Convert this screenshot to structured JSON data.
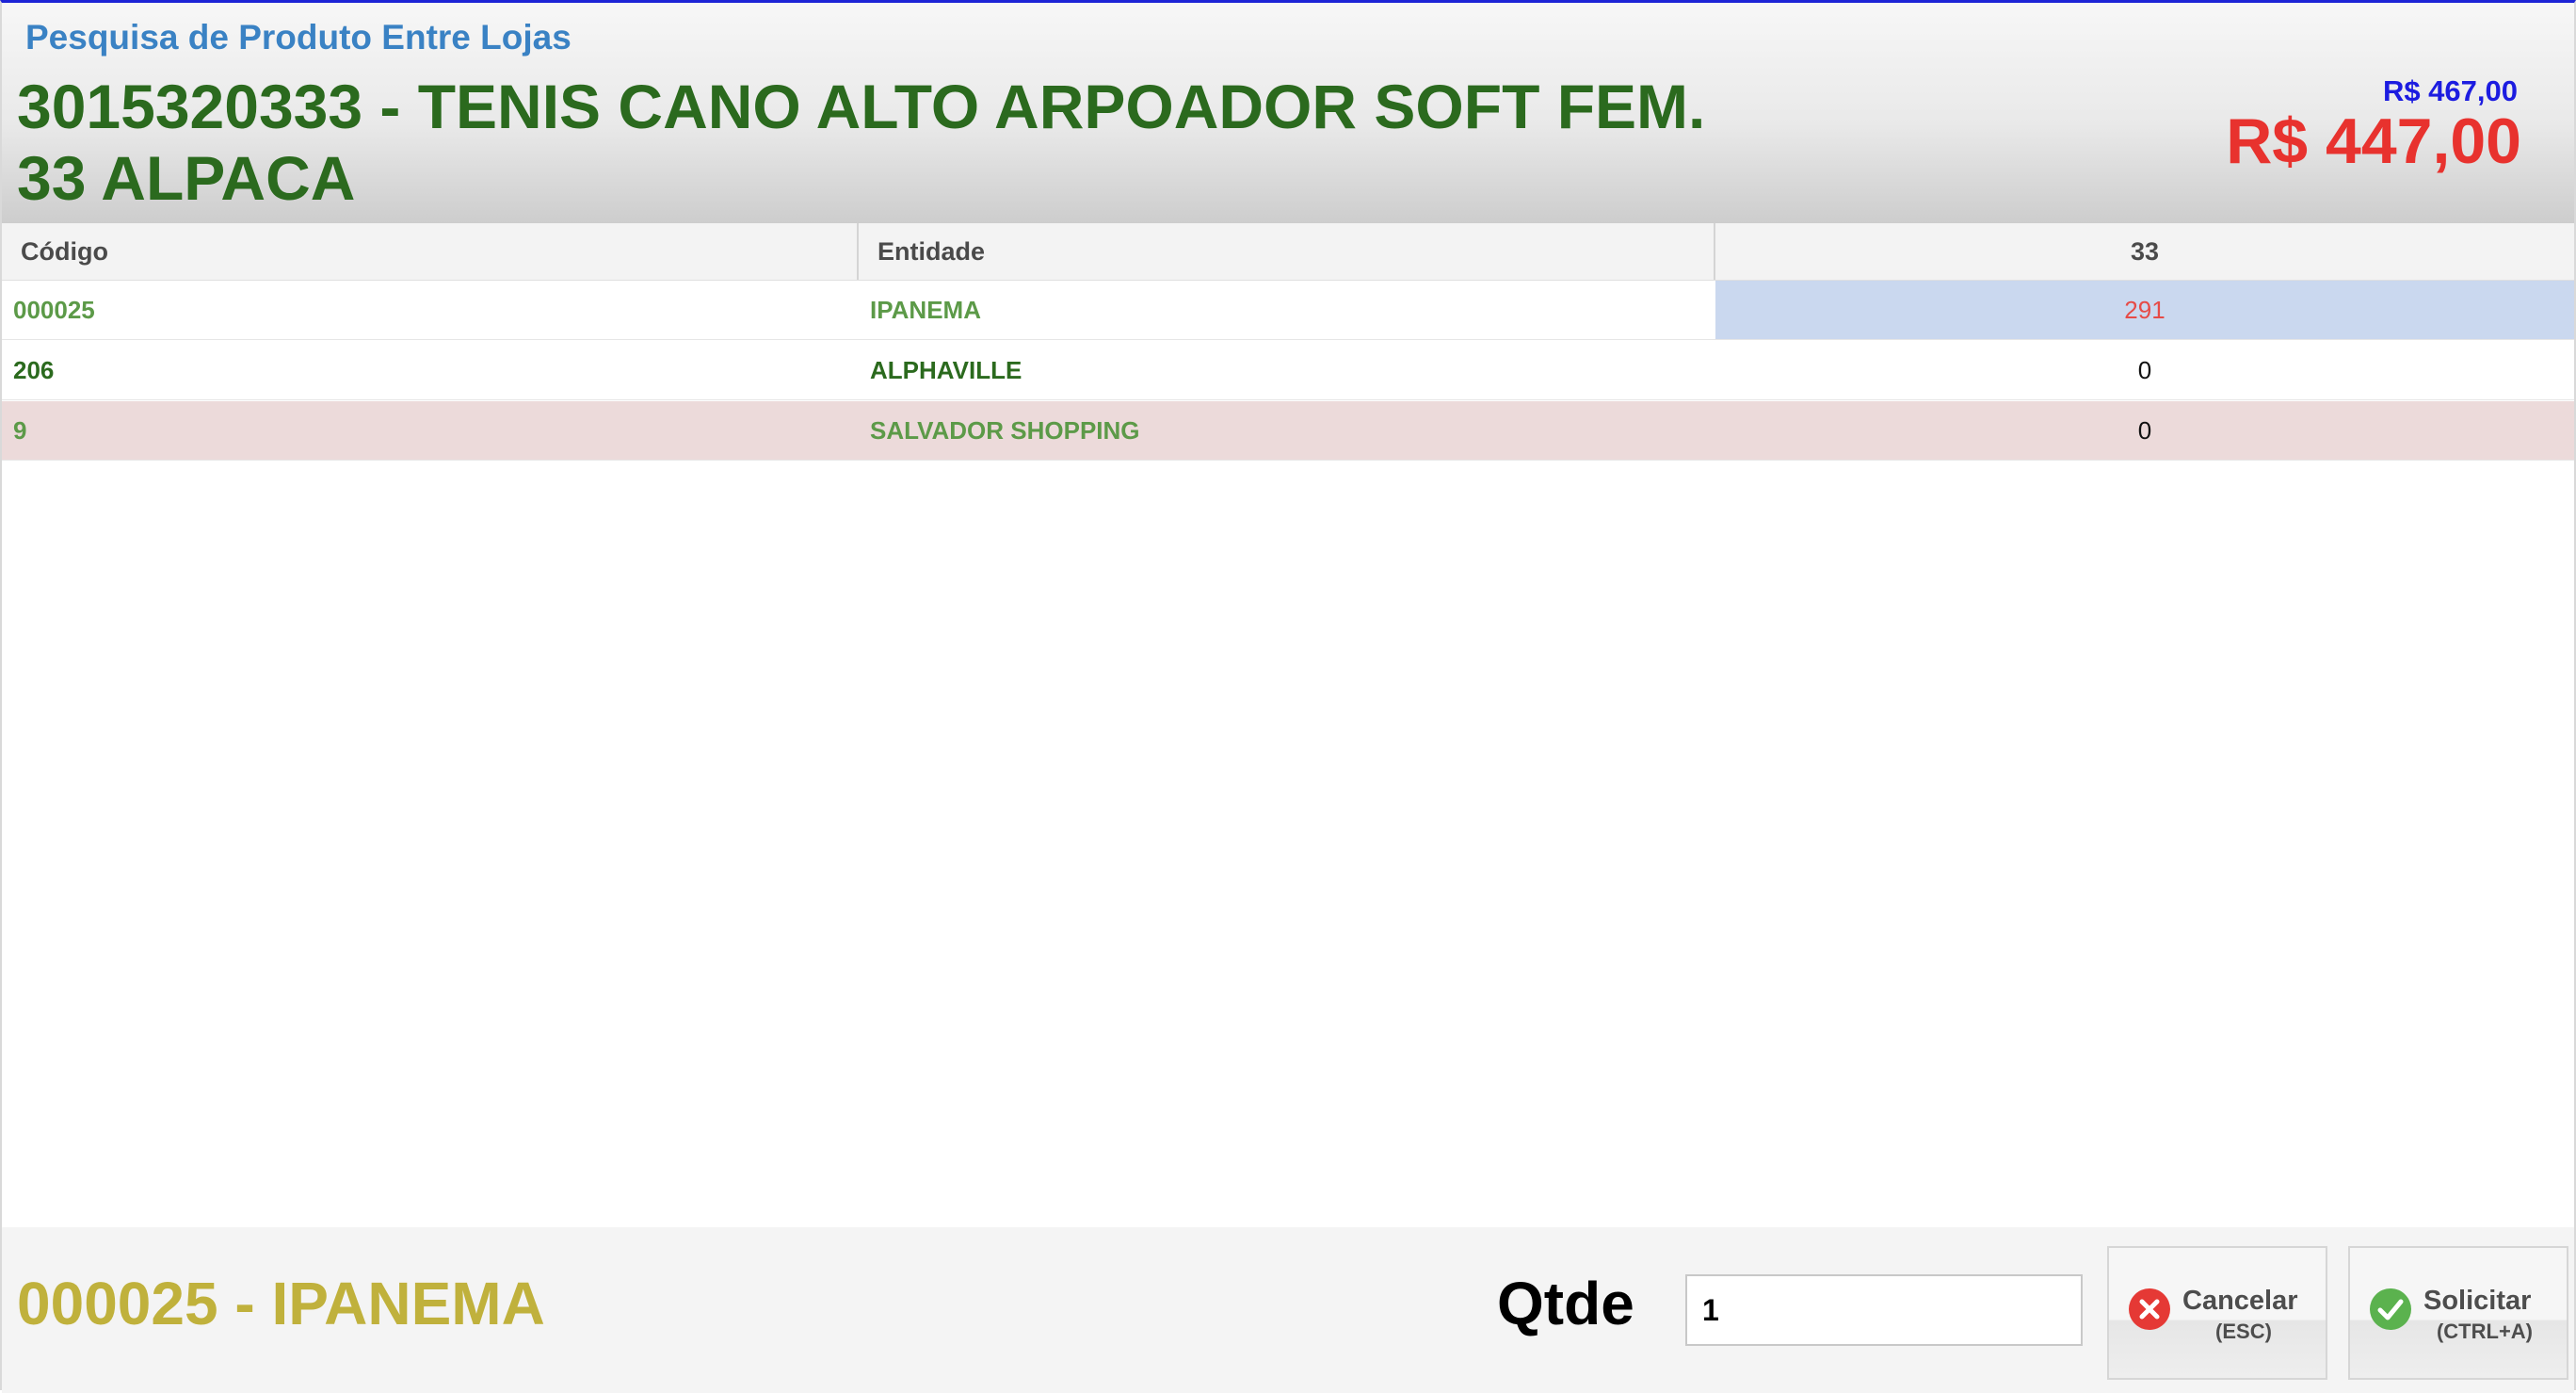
{
  "dialog": {
    "title": "Pesquisa de Produto Entre Lojas"
  },
  "product": {
    "name": "3015320333 - TENIS CANO ALTO ARPOADOR SOFT FEM. 33 ALPACA",
    "price_original": "R$ 467,00",
    "price_current": "R$ 447,00"
  },
  "grid": {
    "columns": {
      "code": "Código",
      "entity": "Entidade",
      "qty": "33"
    },
    "rows": [
      {
        "code": "000025",
        "entity": "IPANEMA",
        "qty": "291"
      },
      {
        "code": "206",
        "entity": "ALPHAVILLE",
        "qty": "0"
      },
      {
        "code": "9",
        "entity": "SALVADOR SHOPPING",
        "qty": "0"
      }
    ]
  },
  "footer": {
    "selected": "000025 - IPANEMA",
    "qty_label": "Qtde",
    "qty_value": "1",
    "cancel_label": "Cancelar",
    "cancel_shortcut": "(ESC)",
    "request_label": "Solicitar",
    "request_shortcut": "(CTRL+A)"
  },
  "colors": {
    "title_blue": "#3a82c4",
    "product_green": "#2b6a1e",
    "price_old_blue": "#1c1ce0",
    "price_new_red": "#e8322e",
    "selected_row_cell": "#cad8ef",
    "highlight_row": "#ecdada",
    "selected_label": "#c0b13c",
    "cancel_icon": "#e53935",
    "request_icon": "#5bb24e"
  },
  "icons": {
    "cancel": "close-circle-icon",
    "request": "check-circle-icon"
  }
}
